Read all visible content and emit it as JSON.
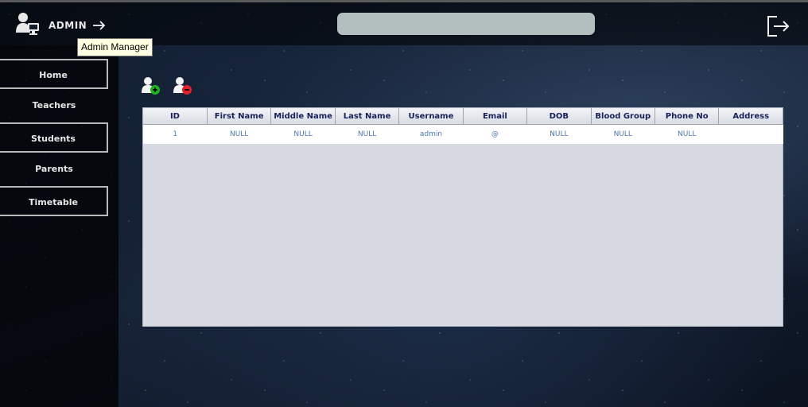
{
  "header": {
    "brand_label": "ADMIN",
    "tooltip": "Admin Manager",
    "search_value": "",
    "search_placeholder": ""
  },
  "sidebar": {
    "items": [
      {
        "label": "Home",
        "boxed": true
      },
      {
        "label": "Teachers",
        "boxed": false
      },
      {
        "label": "Students",
        "boxed": true
      },
      {
        "label": "Parents",
        "boxed": false
      },
      {
        "label": "Timetable",
        "boxed": true
      }
    ]
  },
  "toolbar": {
    "icons": [
      "add-user-icon",
      "remove-user-icon"
    ],
    "colors": {
      "add": "#1db31d",
      "remove": "#e0202a"
    }
  },
  "table": {
    "columns": [
      "ID",
      "First Name",
      "Middle Name",
      "Last Name",
      "Username",
      "Email",
      "DOB",
      "Blood Group",
      "Phone No",
      "Address"
    ],
    "rows": [
      [
        "1",
        "NULL",
        "NULL",
        "NULL",
        "admin",
        "@",
        "NULL",
        "NULL",
        "NULL",
        ""
      ]
    ]
  },
  "colors": {
    "header_text": "#16215a",
    "cell_text": "#4a78b8",
    "panel_bg": "#d7dae2",
    "search_bg": "#b3bfbf"
  }
}
